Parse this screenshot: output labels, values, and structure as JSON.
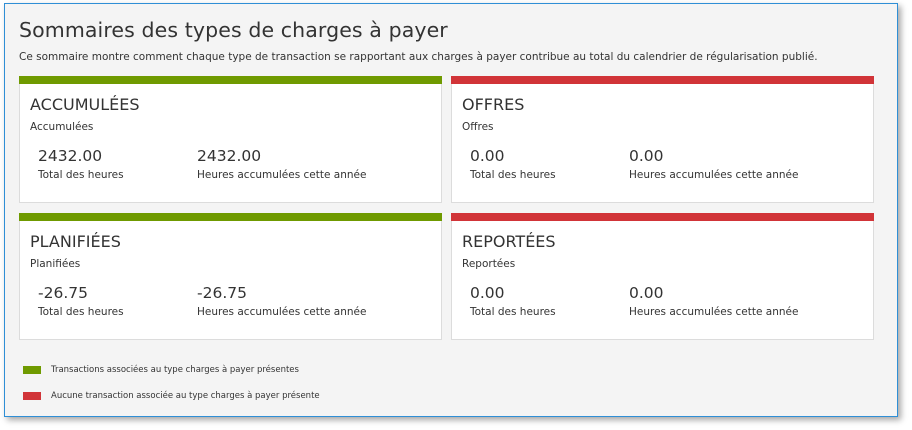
{
  "header": {
    "title": "Sommaires des types de charges à payer",
    "description": "Ce sommaire montre comment chaque type de transaction se rapportant aux charges à payer contribue au total du calendrier de régularisation publié."
  },
  "colors": {
    "present": "#6f9a00",
    "absent": "#d13438"
  },
  "cards": [
    {
      "title": "ACCUMULÉES",
      "subtitle": "Accumulées",
      "status": "present",
      "stats": [
        {
          "value": "2432.00",
          "label": "Total des heures"
        },
        {
          "value": "2432.00",
          "label": "Heures accumulées cette année"
        }
      ]
    },
    {
      "title": "OFFRES",
      "subtitle": "Offres",
      "status": "absent",
      "stats": [
        {
          "value": "0.00",
          "label": "Total des heures"
        },
        {
          "value": "0.00",
          "label": "Heures accumulées cette année"
        }
      ]
    },
    {
      "title": "PLANIFIÉES",
      "subtitle": "Planifiées",
      "status": "present",
      "stats": [
        {
          "value": "-26.75",
          "label": "Total des heures"
        },
        {
          "value": "-26.75",
          "label": "Heures accumulées cette année"
        }
      ]
    },
    {
      "title": "REPORTÉES",
      "subtitle": "Reportées",
      "status": "absent",
      "stats": [
        {
          "value": "0.00",
          "label": "Total des heures"
        },
        {
          "value": "0.00",
          "label": "Heures accumulées cette année"
        }
      ]
    }
  ],
  "legend": [
    {
      "label": "Transactions associées au type charges à payer présentes",
      "status": "present"
    },
    {
      "label": "Aucune transaction associée au type charges à payer présente",
      "status": "absent"
    }
  ]
}
